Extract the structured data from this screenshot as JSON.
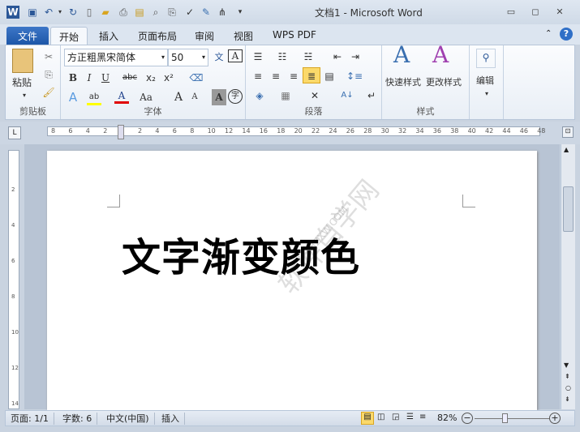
{
  "window": {
    "title": "文档1 - Microsoft Word"
  },
  "quick_access": [
    "word-logo-icon",
    "save-icon",
    "undo-icon",
    "redo-icon",
    "new-doc-icon",
    "open-icon",
    "print-icon",
    "folder-icon",
    "print-preview-icon",
    "attach-icon",
    "spelling-icon",
    "edit-icon",
    "org-chart-icon",
    "customize-icon"
  ],
  "tabs": {
    "file": "文件",
    "items": [
      "开始",
      "插入",
      "页面布局",
      "审阅",
      "视图",
      "WPS PDF"
    ]
  },
  "ribbon": {
    "clipboard": {
      "label": "剪贴板",
      "paste": "粘贴"
    },
    "font": {
      "label": "字体",
      "font_name": "方正粗黑宋简体",
      "font_size": "50",
      "bold": "B",
      "italic": "I",
      "underline": "U",
      "strike": "abc",
      "sub": "x₂",
      "sup": "x²",
      "case": "Aa",
      "grow": "A",
      "shrink": "A",
      "char_shade": "A",
      "enclose": "字",
      "color": "#e00000"
    },
    "paragraph": {
      "label": "段落"
    },
    "styles": {
      "label": "样式",
      "quick": "快速样式",
      "change": "更改样式"
    },
    "editing": {
      "label": "编辑"
    }
  },
  "ruler": {
    "ticks": [
      "8",
      "6",
      "4",
      "2",
      "",
      "2",
      "4",
      "6",
      "8",
      "10",
      "12",
      "14",
      "16",
      "18",
      "20",
      "22",
      "24",
      "26",
      "28",
      "30",
      "32",
      "34",
      "36",
      "38",
      "40",
      "42",
      "44",
      "46",
      "48"
    ]
  },
  "document": {
    "text": "文字渐变颜色",
    "watermark": "软件自学网",
    "watermark_url": "RJZXW.COM"
  },
  "status": {
    "page": "页面: 1/1",
    "words": "字数: 6",
    "lang": "中文(中国)",
    "mode": "插入",
    "zoom": "82%",
    "zoom_percent": 82
  }
}
